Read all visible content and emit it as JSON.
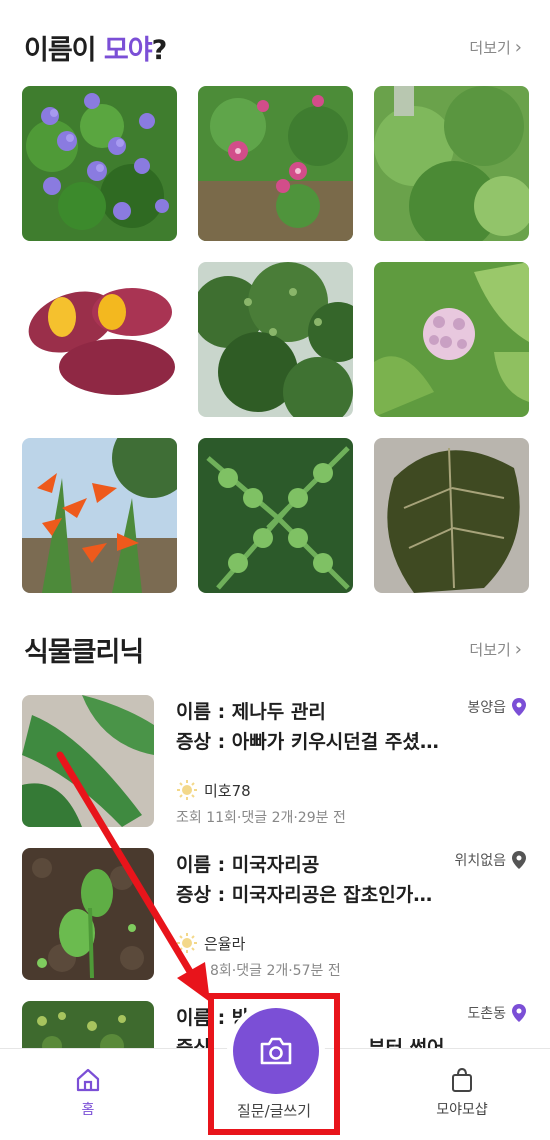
{
  "section1": {
    "title_prefix": "이름이 ",
    "title_accent": "모야",
    "title_suffix": "?",
    "more_label": "더보기"
  },
  "section2": {
    "title": "식물클리닉",
    "more_label": "더보기"
  },
  "posts": [
    {
      "name": "이름 : 제나두 관리",
      "symptom": "증상 : 아빠가 키우시던걸 주셨…",
      "location": "봉양읍",
      "author": "미호78",
      "stats": "조회 11회·댓글 2개·29분 전"
    },
    {
      "name": "이름 : 미국자리공",
      "symptom": "증상 : 미국자리공은 잡초인가…",
      "location": "위치없음",
      "author": "은율라",
      "stats": "8회·댓글 2개·57분 전"
    },
    {
      "name": "이름 : 방",
      "symptom": "증상",
      "location": "도촌동",
      "symptom_tail": "부터 썩어…"
    }
  ],
  "nav": {
    "home_label": "홈",
    "write_label": "질문/글쓰기",
    "shop_label": "모야모샵"
  },
  "colors": {
    "accent": "#7b4fd6",
    "highlight": "#e8141b"
  }
}
